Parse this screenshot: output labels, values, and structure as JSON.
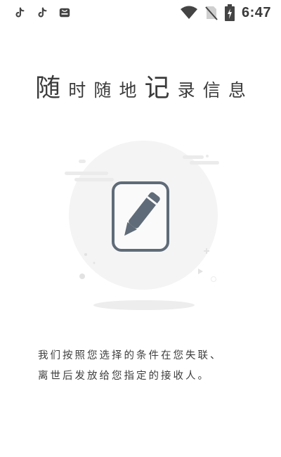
{
  "status_bar": {
    "time": "6:47",
    "left_icons": [
      "tiktok-icon",
      "tiktok-icon",
      "shop-icon"
    ],
    "right_icons": [
      "wifi-icon",
      "no-sim-icon",
      "battery-charging-icon"
    ]
  },
  "headline": {
    "chars": [
      "随",
      "时",
      "随",
      "地",
      "记",
      "录",
      "信",
      "息"
    ]
  },
  "description": {
    "line1": "我们按照您选择的条件在您失联、",
    "line2": "离世后发放给您指定的接收人。"
  },
  "illustration": {
    "icon": "edit-pencil-icon",
    "accent_color": "#5f6b78",
    "circle_color": "#f4f4f4"
  }
}
